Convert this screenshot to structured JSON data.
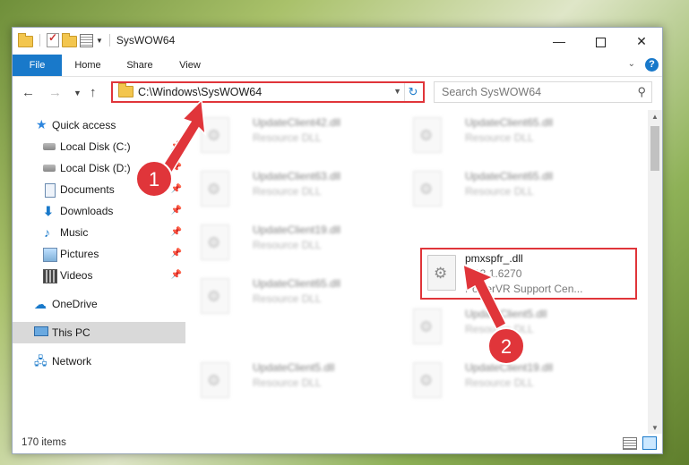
{
  "window": {
    "title": "SysWOW64"
  },
  "ribbon": {
    "tabs": [
      "File",
      "Home",
      "Share",
      "View"
    ]
  },
  "address": {
    "path": "C:\\Windows\\SysWOW64",
    "search_placeholder": "Search SysWOW64"
  },
  "navpane": {
    "items": [
      {
        "label": "Quick access",
        "icon": "star-icon"
      },
      {
        "label": "Local Disk (C:)",
        "icon": "disk-icon",
        "pinned": true
      },
      {
        "label": "Local Disk (D:)",
        "icon": "disk-icon",
        "pinned": true
      },
      {
        "label": "Documents",
        "icon": "documents-icon",
        "pinned": true
      },
      {
        "label": "Downloads",
        "icon": "downloads-icon",
        "pinned": true
      },
      {
        "label": "Music",
        "icon": "music-icon",
        "pinned": true
      },
      {
        "label": "Pictures",
        "icon": "pictures-icon",
        "pinned": true
      },
      {
        "label": "Videos",
        "icon": "videos-icon",
        "pinned": true
      },
      {
        "label": "OneDrive",
        "icon": "onedrive-icon"
      },
      {
        "label": "This PC",
        "icon": "computer-icon"
      },
      {
        "label": "Network",
        "icon": "network-icon"
      }
    ]
  },
  "files": [
    {
      "name": "UpdateClient42.dll",
      "line2": "Resource DLL",
      "line3": ""
    },
    {
      "name": "UpdateClient65.dll",
      "line2": "Resource DLL",
      "line3": ""
    },
    {
      "name": "UpdateClient63.dll",
      "line2": "Resource DLL",
      "line3": ""
    },
    {
      "name": "UpdateClient65.dll",
      "line2": "Resource DLL",
      "line3": ""
    },
    {
      "name": "UpdateClient19.dll",
      "line2": "Resource DLL",
      "line3": ""
    },
    {
      "name": "pmxspfr_.dll",
      "line2": "5.13.1.6270",
      "line3": "PowerVR Support Cen..."
    },
    {
      "name": "UpdateClient65.dll",
      "line2": "Resource DLL",
      "line3": ""
    },
    {
      "name": "UpdateClient5.dll",
      "line2": "Resource DLL",
      "line3": ""
    },
    {
      "name": "UpdateClient5.dll",
      "line2": "Resource DLL",
      "line3": ""
    },
    {
      "name": "UpdateClient19.dll",
      "line2": "Resource DLL",
      "line3": ""
    }
  ],
  "status": {
    "item_count": "170 items"
  },
  "annotations": {
    "step1": "1",
    "step2": "2",
    "color": "#e0353a"
  }
}
